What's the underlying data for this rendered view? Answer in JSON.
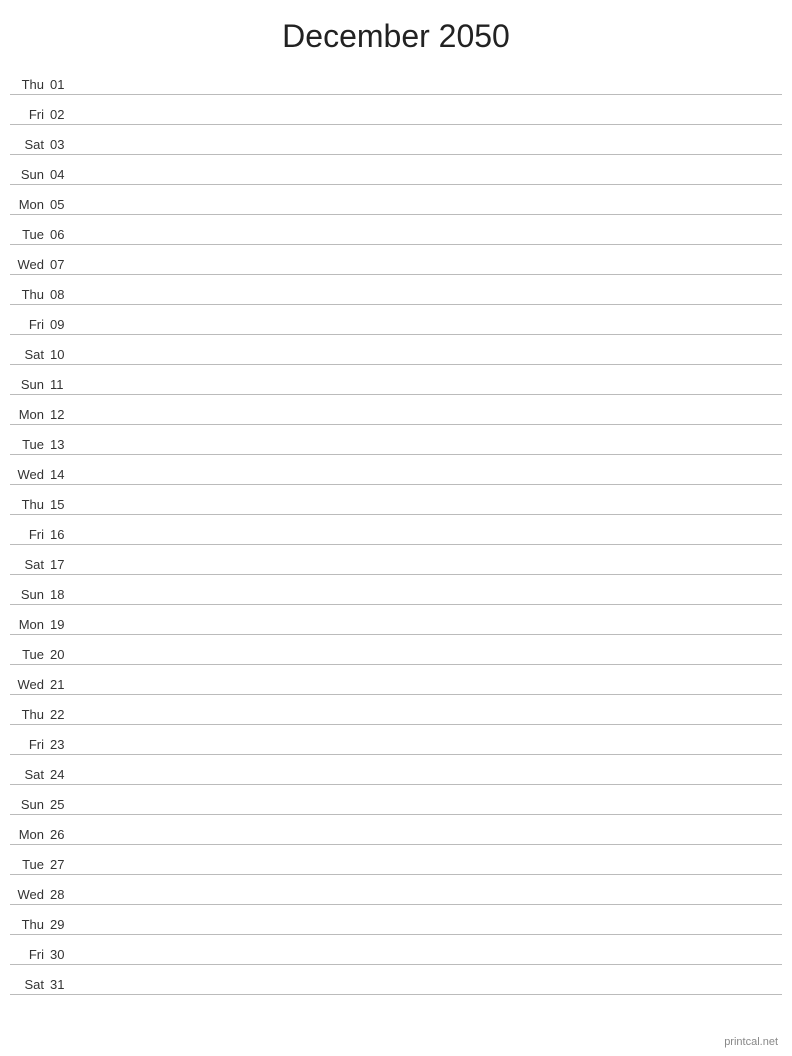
{
  "title": "December 2050",
  "footer": "printcal.net",
  "days": [
    {
      "name": "Thu",
      "num": "01"
    },
    {
      "name": "Fri",
      "num": "02"
    },
    {
      "name": "Sat",
      "num": "03"
    },
    {
      "name": "Sun",
      "num": "04"
    },
    {
      "name": "Mon",
      "num": "05"
    },
    {
      "name": "Tue",
      "num": "06"
    },
    {
      "name": "Wed",
      "num": "07"
    },
    {
      "name": "Thu",
      "num": "08"
    },
    {
      "name": "Fri",
      "num": "09"
    },
    {
      "name": "Sat",
      "num": "10"
    },
    {
      "name": "Sun",
      "num": "11"
    },
    {
      "name": "Mon",
      "num": "12"
    },
    {
      "name": "Tue",
      "num": "13"
    },
    {
      "name": "Wed",
      "num": "14"
    },
    {
      "name": "Thu",
      "num": "15"
    },
    {
      "name": "Fri",
      "num": "16"
    },
    {
      "name": "Sat",
      "num": "17"
    },
    {
      "name": "Sun",
      "num": "18"
    },
    {
      "name": "Mon",
      "num": "19"
    },
    {
      "name": "Tue",
      "num": "20"
    },
    {
      "name": "Wed",
      "num": "21"
    },
    {
      "name": "Thu",
      "num": "22"
    },
    {
      "name": "Fri",
      "num": "23"
    },
    {
      "name": "Sat",
      "num": "24"
    },
    {
      "name": "Sun",
      "num": "25"
    },
    {
      "name": "Mon",
      "num": "26"
    },
    {
      "name": "Tue",
      "num": "27"
    },
    {
      "name": "Wed",
      "num": "28"
    },
    {
      "name": "Thu",
      "num": "29"
    },
    {
      "name": "Fri",
      "num": "30"
    },
    {
      "name": "Sat",
      "num": "31"
    }
  ]
}
